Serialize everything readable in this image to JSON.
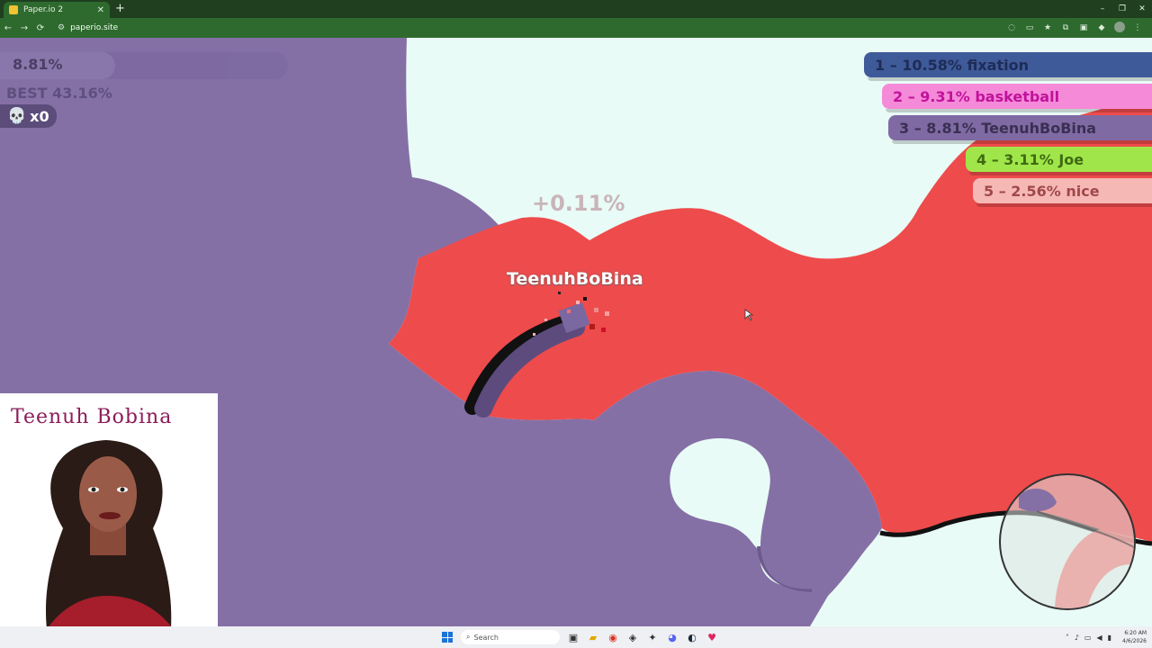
{
  "browser": {
    "tab_title": "Paper.io 2",
    "tab_close": "✕",
    "new_tab": "+",
    "url": "paperio.site",
    "nav": {
      "back": "←",
      "forward": "→",
      "reload": "⟳"
    },
    "window_controls": {
      "minimize": "–",
      "maximize": "❐",
      "close": "✕"
    }
  },
  "hud": {
    "self_percent": "8.81%",
    "self_fraction": 0.0881,
    "best": "BEST 43.16%",
    "kills": "x0",
    "gain": "+0.11%",
    "player_name": "TeenuhBoBina"
  },
  "leaderboard": [
    {
      "text": "1 – 10.58% fixation",
      "bg": "#3f5a99",
      "fg": "#1e2c57"
    },
    {
      "text": "2 – 9.31% basketball",
      "bg": "#f58ad8",
      "fg": "#c1129b"
    },
    {
      "text": "3 – 8.81% TeenuhBoBina",
      "bg": "#7f6aa3",
      "fg": "#3a2f52"
    },
    {
      "text": "4 – 3.11% Joe",
      "bg": "#a0e64a",
      "fg": "#3f6a12"
    },
    {
      "text": "5 – 2.56% nice",
      "bg": "#f6b8b4",
      "fg": "#a0484a"
    }
  ],
  "webcam": {
    "label": "Teenuh Bobina"
  },
  "taskbar": {
    "search_placeholder": "Search",
    "time": "6:20 AM",
    "date": "4/6/2026"
  },
  "colors": {
    "player": "#8570a6",
    "enemy": "#ee4b4c",
    "background": "#e9fbf6",
    "trail": "#5d4b7d"
  }
}
